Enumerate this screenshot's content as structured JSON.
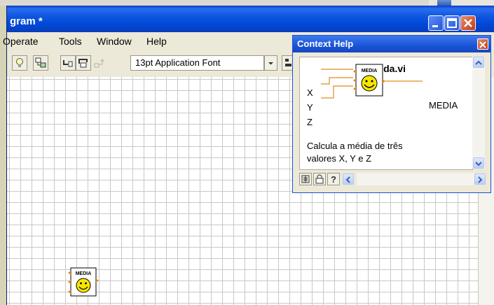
{
  "main_window": {
    "title": "gram *",
    "controls": {
      "minimize": "minimize-icon",
      "maximize": "maximize-icon",
      "close": "close-icon"
    }
  },
  "menu": {
    "items": [
      {
        "label": "Operate"
      },
      {
        "label": "Tools"
      },
      {
        "label": "Window"
      },
      {
        "label": "Help"
      }
    ]
  },
  "toolbar": {
    "font_selector": "13pt Application Font"
  },
  "context_help": {
    "title": "Context Help",
    "vi_name": "meida.vi",
    "node_label": "MEDIA",
    "terminals": {
      "x": "X",
      "y": "Y",
      "z": "Z",
      "output": "MEDIA"
    },
    "description": [
      "Calcula a média de três",
      "valores X, Y e Z"
    ]
  },
  "diagram": {
    "node_label": "MEDIA"
  },
  "colors": {
    "wire": "#e08a1e",
    "face": "#f5e600",
    "titlebar": "#0a4ad8"
  }
}
